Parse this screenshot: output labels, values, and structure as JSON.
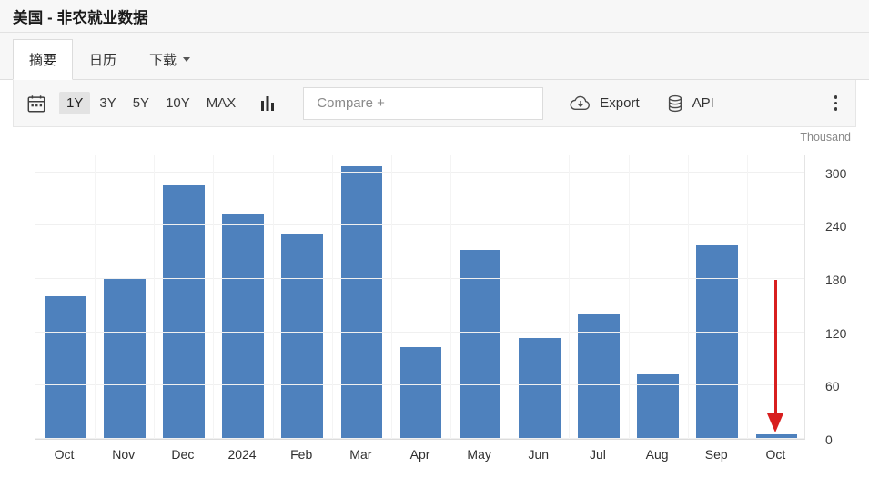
{
  "header": {
    "title": "美国 - 非农就业数据"
  },
  "tabs": [
    {
      "label": "摘要",
      "active": true,
      "has_caret": false,
      "name": "tab-summary"
    },
    {
      "label": "日历",
      "active": false,
      "has_caret": false,
      "name": "tab-calendar"
    },
    {
      "label": "下载",
      "active": false,
      "has_caret": true,
      "name": "tab-download"
    }
  ],
  "toolbar": {
    "calendar_icon": "calendar-icon",
    "ranges": [
      {
        "label": "1Y",
        "selected": true
      },
      {
        "label": "3Y",
        "selected": false
      },
      {
        "label": "5Y",
        "selected": false
      },
      {
        "label": "10Y",
        "selected": false
      },
      {
        "label": "MAX",
        "selected": false
      }
    ],
    "chart_type_icon": "bar-chart-icon",
    "compare_placeholder": "Compare +",
    "compare_value": "",
    "export_label": "Export",
    "export_icon": "cloud-download-icon",
    "api_label": "API",
    "api_icon": "database-icon",
    "more_icon": "kebab-menu-icon"
  },
  "chart_data": {
    "type": "bar",
    "title": "",
    "unit_label": "Thousand",
    "xlabel": "",
    "ylabel": "",
    "categories": [
      "Oct",
      "Nov",
      "Dec",
      "2024",
      "Feb",
      "Mar",
      "Apr",
      "May",
      "Jun",
      "Jul",
      "Aug",
      "Sep",
      "Oct"
    ],
    "values": [
      161,
      180,
      285,
      253,
      231,
      307,
      103,
      213,
      114,
      140,
      73,
      218,
      5
    ],
    "ylim": [
      0,
      320
    ],
    "yticks": [
      0,
      60,
      120,
      180,
      240,
      300
    ],
    "grid": true,
    "legend": "none",
    "series_color": "#4e81bd",
    "annotation": {
      "type": "arrow",
      "color": "#d81f1f",
      "from_value": 180,
      "to_value": 8,
      "at_category": "Oct"
    }
  }
}
